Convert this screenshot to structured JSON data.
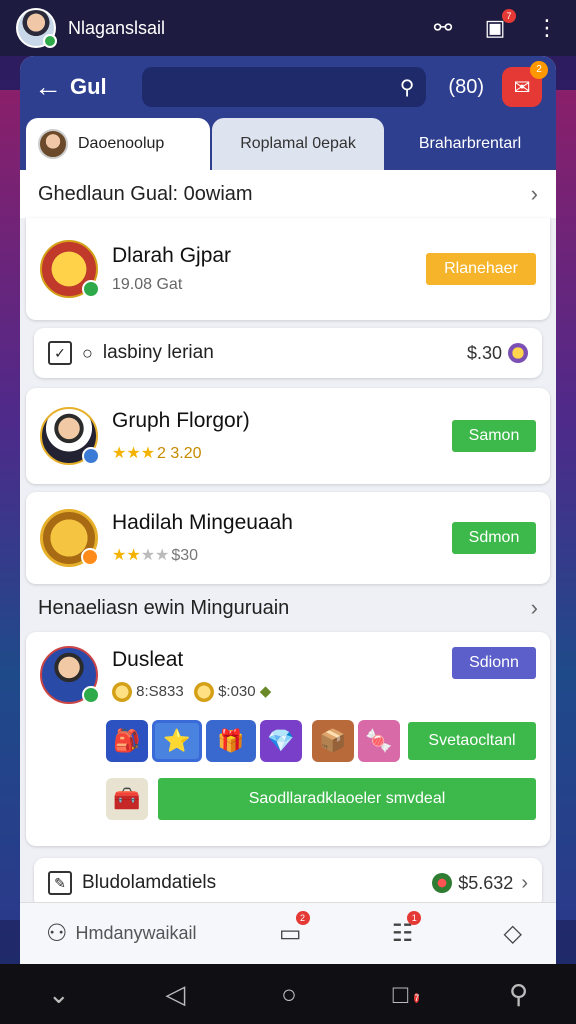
{
  "status_bar": {
    "username": "Nlaganslsail",
    "notif_badge": "7"
  },
  "header": {
    "title": "Gul",
    "count": "(80)",
    "action_badge": "2"
  },
  "tabs": [
    {
      "label": "Daoenoolup"
    },
    {
      "label": "Roplamal 0epak"
    },
    {
      "label": "Braharbrentarl"
    }
  ],
  "section1": {
    "title": "Ghedlaun Gual: 0owiam"
  },
  "featured": {
    "name": "Dlarah Gjpar",
    "sub": "19.08 Gat",
    "button": "Rlanehaer"
  },
  "line1": {
    "text": "lasbiny lerian",
    "amount": "$.30"
  },
  "item1": {
    "name": "Gruph Florgor)",
    "rating": "2 3.20",
    "button": "Samon"
  },
  "item2": {
    "name": "Hadilah Mingeuaah",
    "rating": "$30",
    "button": "Sdmon"
  },
  "section2": {
    "title": "Henaeliasn ewin Minguruain"
  },
  "dusleat": {
    "name": "Dusleat",
    "coin1": "8:S833",
    "coin2": "$:030",
    "button": "Sdionn",
    "green_btn": "Svetaocltanl",
    "wide_btn": "Saodllaradklaoeler smvdeal"
  },
  "line2": {
    "text": "Bludolamdatiels",
    "amount": "$5.632"
  },
  "bottom_nav": {
    "item1": "Hmdanywaikail",
    "badge1": "2",
    "badge2": "1"
  },
  "system_nav": {
    "badge": "7"
  },
  "colors": {
    "header": "#2f3f8f",
    "accent_red": "#e53935",
    "green": "#3db84a",
    "yellow": "#f6b42a",
    "purple": "#5c5fc9"
  }
}
